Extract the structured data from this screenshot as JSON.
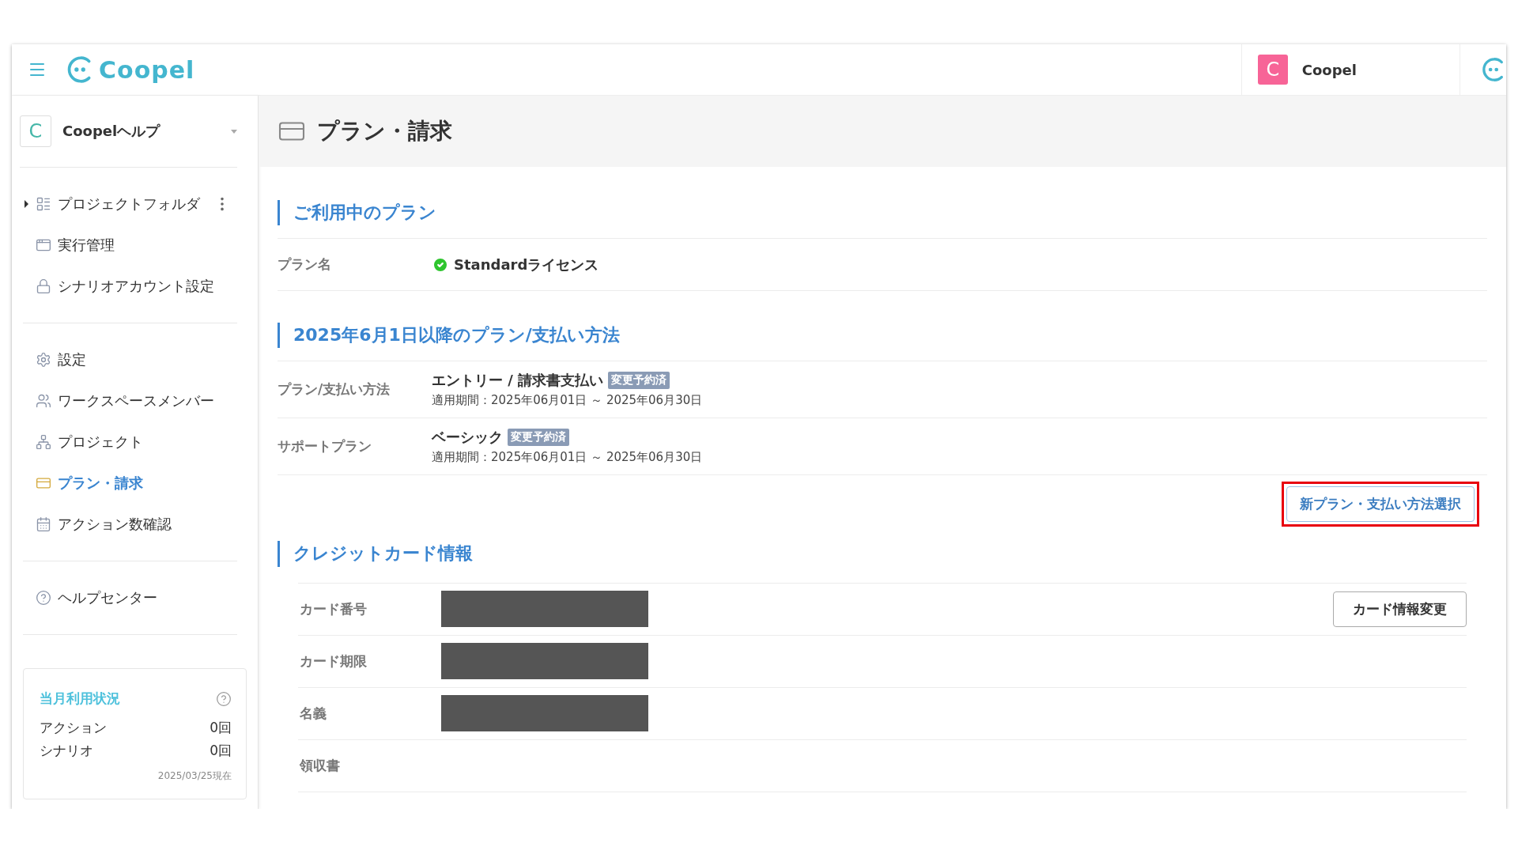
{
  "header": {
    "logo_text": "Coopel",
    "user": {
      "avatar_letter": "C",
      "name": "Coopel"
    }
  },
  "sidebar": {
    "workspace": {
      "avatar_letter": "C",
      "name": "Coopelヘルプ"
    },
    "groups": [
      [
        {
          "label": "プロジェクトフォルダ",
          "selected": false,
          "expanded": false
        },
        {
          "label": "実行管理",
          "selected": false
        },
        {
          "label": "シナリオアカウント設定",
          "selected": false
        }
      ],
      [
        {
          "label": "設定",
          "selected": false
        },
        {
          "label": "ワークスペースメンバー",
          "selected": false
        },
        {
          "label": "プロジェクト",
          "selected": false
        },
        {
          "label": "プラン・請求",
          "selected": true
        },
        {
          "label": "アクション数確認",
          "selected": false
        }
      ],
      [
        {
          "label": "ヘルプセンター",
          "selected": false
        }
      ]
    ],
    "usage": {
      "title": "当月利用状況",
      "rows": [
        {
          "label": "アクション",
          "value": "0回"
        },
        {
          "label": "シナリオ",
          "value": "0回"
        }
      ],
      "note": "2025/03/25現在"
    }
  },
  "page": {
    "title": "プラン・請求",
    "current_plan": {
      "heading": "ご利用中のプラン",
      "rows": [
        {
          "label": "プラン名",
          "value": "Standardライセンス",
          "active": true
        }
      ]
    },
    "future_plan": {
      "heading": "2025年6月1日以降のプラン/支払い方法",
      "rows": [
        {
          "label": "プラン/支払い方法",
          "value": "エントリー / 請求書支払い",
          "badge": "変更予約済",
          "period": "適用期間：2025年06月01日 ～ 2025年06月30日"
        },
        {
          "label": "サポートプラン",
          "value": "ベーシック",
          "badge": "変更予約済",
          "period": "適用期間：2025年06月01日 ～ 2025年06月30日"
        }
      ],
      "button": {
        "label": "新プラン・支払い方法選択",
        "highlighted": true
      }
    },
    "credit_card": {
      "heading": "クレジットカード情報",
      "button": "カード情報変更",
      "rows": [
        {
          "label": "カード番号",
          "redacted": true
        },
        {
          "label": "カード期限",
          "redacted": true
        },
        {
          "label": "名義",
          "redacted": true
        },
        {
          "label": "領収書",
          "redacted": false
        }
      ]
    }
  }
}
